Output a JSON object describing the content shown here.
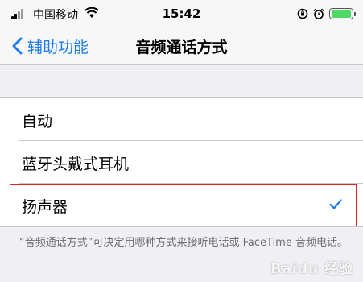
{
  "status_bar": {
    "carrier": "中国移动",
    "time": "15:42",
    "icons": [
      "signal-icon",
      "wifi-icon",
      "rotation-lock-icon",
      "alarm-icon",
      "battery-icon"
    ],
    "battery_color": "#4cd964"
  },
  "nav": {
    "back_label": "辅助功能",
    "title": "音频通话方式",
    "accent": "#1a7cf4"
  },
  "options": [
    {
      "label": "自动",
      "selected": false
    },
    {
      "label": "蓝牙头戴式耳机",
      "selected": false
    },
    {
      "label": "扬声器",
      "selected": true
    }
  ],
  "footer_text": "“音频通话方式”可决定用哪种方式来接听电话或 FaceTime 音频电话。",
  "watermark": "Baidu 经验"
}
